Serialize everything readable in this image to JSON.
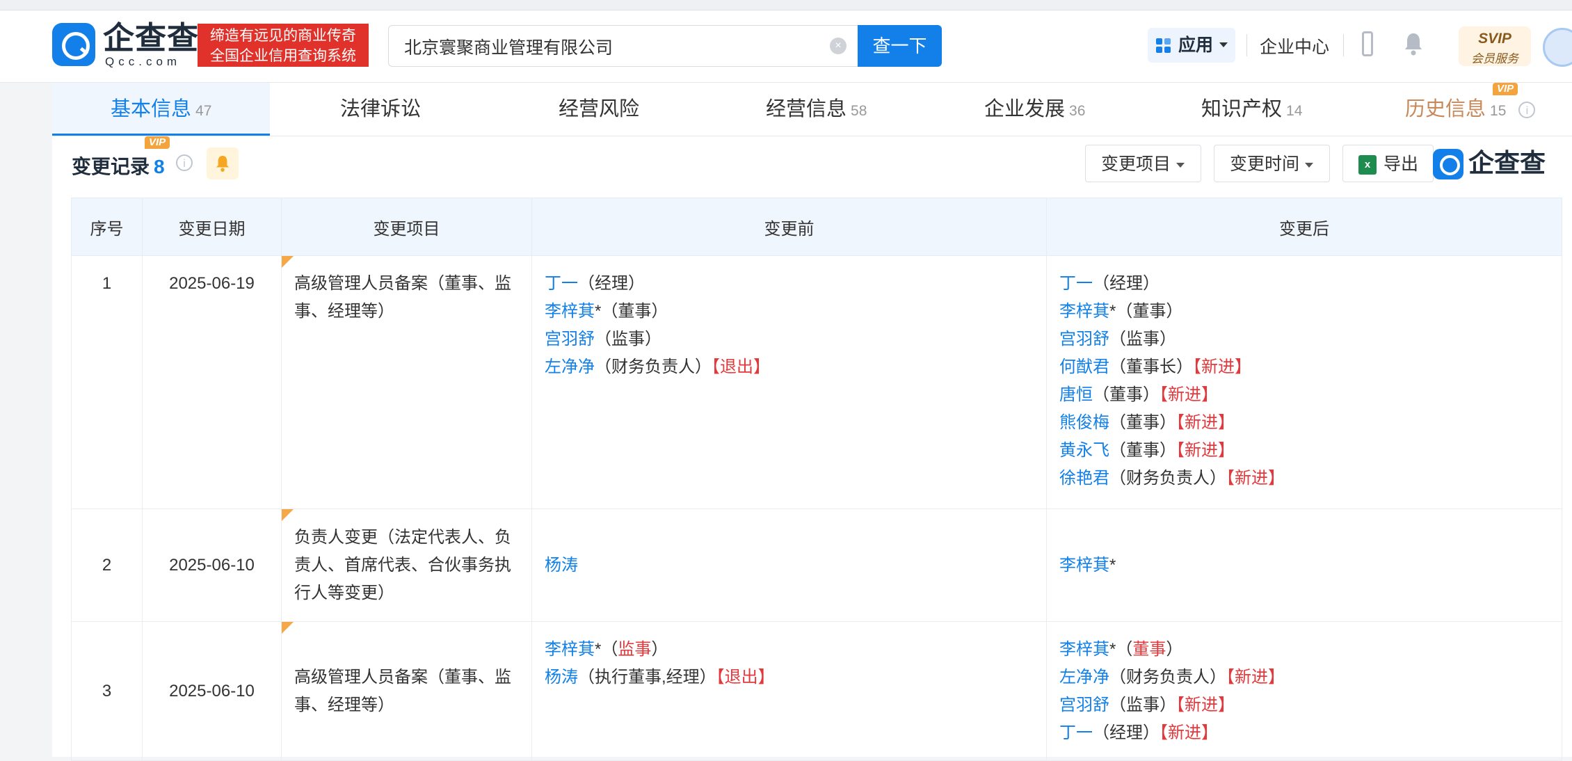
{
  "header": {
    "brand_name": "企查查",
    "brand_domain": "Qcc.com",
    "slogan_line1": "缔造有远见的商业传奇",
    "slogan_line2": "全国企业信用查询系统",
    "search_value": "北京寰聚商业管理有限公司",
    "search_button": "查一下",
    "apps_label": "应用",
    "enterprise_center": "企业中心",
    "svip_title": "SVIP",
    "svip_sub": "会员服务"
  },
  "tabs": [
    {
      "label": "基本信息",
      "count": "47",
      "active": true
    },
    {
      "label": "法律诉讼",
      "count": ""
    },
    {
      "label": "经营风险",
      "count": ""
    },
    {
      "label": "经营信息",
      "count": "58"
    },
    {
      "label": "企业发展",
      "count": "36"
    },
    {
      "label": "知识产权",
      "count": "14"
    },
    {
      "label": "历史信息",
      "count": "15",
      "vip": "VIP"
    }
  ],
  "section": {
    "title": "变更记录",
    "count": "8",
    "vip": "VIP",
    "filter_item": "变更项目",
    "filter_time": "变更时间",
    "export": "导出",
    "excel_letter": "x",
    "watermark_brand": "企查查"
  },
  "table": {
    "headers": [
      "序号",
      "变更日期",
      "变更项目",
      "变更前",
      "变更后"
    ],
    "rows": [
      {
        "idx": "1",
        "date": "2025-06-19",
        "item": "高级管理人员备案（董事、监事、经理等）",
        "before": [
          {
            "name": "丁一",
            "role": "（经理）",
            "tag": ""
          },
          {
            "name": "李梓萁",
            "role": "*（董事）",
            "tag": ""
          },
          {
            "name": "宫羽舒",
            "role": "（监事）",
            "tag": ""
          },
          {
            "name": "左净净",
            "role": "（财务负责人）",
            "tag": "【退出】"
          }
        ],
        "after": [
          {
            "name": "丁一",
            "role": "（经理）",
            "tag": ""
          },
          {
            "name": "李梓萁",
            "role": "*（董事）",
            "tag": ""
          },
          {
            "name": "宫羽舒",
            "role": "（监事）",
            "tag": ""
          },
          {
            "name": "何猷君",
            "role": "（董事长）",
            "tag": "【新进】"
          },
          {
            "name": "唐恒",
            "role": "（董事）",
            "tag": "【新进】"
          },
          {
            "name": "熊俊梅",
            "role": "（董事）",
            "tag": "【新进】"
          },
          {
            "name": "黄永飞",
            "role": "（董事）",
            "tag": "【新进】"
          },
          {
            "name": "徐艳君",
            "role": "（财务负责人）",
            "tag": "【新进】"
          }
        ]
      },
      {
        "idx": "2",
        "date": "2025-06-10",
        "item": "负责人变更（法定代表人、负责人、首席代表、合伙事务执行人等变更）",
        "before": [
          {
            "name": "杨涛",
            "role": "",
            "tag": ""
          }
        ],
        "after": [
          {
            "name": "李梓萁",
            "role": "*",
            "tag": ""
          }
        ]
      },
      {
        "idx": "3",
        "date": "2025-06-10",
        "item": "高级管理人员备案（董事、监事、经理等）",
        "before": [
          {
            "name": "李梓萁",
            "role": "*（",
            "role_red": "监事",
            "role_end": "）",
            "tag": ""
          },
          {
            "name": "杨涛",
            "role": "（执行董事,经理）",
            "tag": "【退出】"
          }
        ],
        "after": [
          {
            "name": "李梓萁",
            "role": "*（",
            "role_red": "董事",
            "role_end": "）",
            "tag": ""
          },
          {
            "name": "左净净",
            "role": "（财务负责人）",
            "tag": "【新进】"
          },
          {
            "name": "宫羽舒",
            "role": "（监事）",
            "tag": "【新进】"
          },
          {
            "name": "丁一",
            "role": "（经理）",
            "tag": "【新进】"
          }
        ]
      }
    ]
  },
  "colors": {
    "primary": "#1280e8",
    "danger": "#e4393c",
    "vip": "#f3a43c"
  }
}
